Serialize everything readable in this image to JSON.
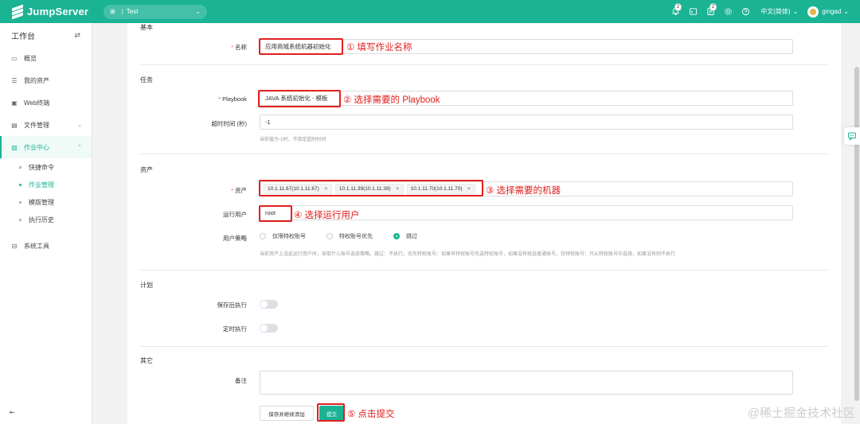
{
  "app": {
    "brand": "JumpServer",
    "org": "Test",
    "org_sep": "|",
    "lang": "中文(简体)",
    "user": "gingad"
  },
  "topbar": {
    "badge_1": "2",
    "badge_2": "2"
  },
  "sidebar": {
    "title": "工作台",
    "items": [
      {
        "label": "概览"
      },
      {
        "label": "我的资产"
      },
      {
        "label": "Web终端"
      },
      {
        "label": "文件管理"
      },
      {
        "label": "作业中心"
      }
    ],
    "sub": [
      {
        "label": "快捷命令"
      },
      {
        "label": "作业管理"
      },
      {
        "label": "模版管理"
      },
      {
        "label": "执行历史"
      }
    ],
    "system_tools": "系统工具"
  },
  "form": {
    "section_basic": "基本",
    "name_label": "名称",
    "name_value": "应用商城系统机器初始化",
    "section_task": "任务",
    "playbook_label": "Playbook",
    "playbook_value": "JAVA 系统初始化 - 模板",
    "timeout_label": "超时时间 (秒)",
    "timeout_value": "-1",
    "timeout_hint": "当前值为-1时，不指定超时时间",
    "section_assets": "资产",
    "assets_label": "资产",
    "assets": [
      "10.1.11.67(10.1.11.67)",
      "10.1.11.39(10.1.11.39)",
      "10.1.11.70(10.1.11.70)"
    ],
    "runas_label": "运行用户",
    "runas_value": "root",
    "policy_label": "用户策略",
    "policy_options": [
      "仅限特权账号",
      "特权账号优先",
      "跳过"
    ],
    "policy_hint": "当前资产上没此运行用户时，采取什么账号选择策略。跳过：不执行。优先特权账号：如果有特权账号先选特权账号，如果没有就选普通账号。仅特权账号：只从特权账号中选择，如果没有则不执行",
    "section_plan": "计划",
    "run_after_save_label": "保存后执行",
    "timed_label": "定时执行",
    "section_other": "其它",
    "comment_label": "备注",
    "save_continue": "保存并继续添加",
    "submit": "提交"
  },
  "annotations": {
    "a1": "① 填写作业名称",
    "a2": "② 选择需要的 Playbook",
    "a3": "③ 选择需要的机器",
    "a4": "④ 选择运行用户",
    "a5": "⑤ 点击提交"
  },
  "watermark": "@稀土掘金技术社区",
  "icons": [
    "logo-icon",
    "org-icon",
    "bell-icon",
    "terminal-icon",
    "tasks-icon",
    "gear-icon",
    "help-icon",
    "chevron-down-icon"
  ],
  "colors": {
    "brand": "#1ab394",
    "annotation": "#e0201e"
  }
}
